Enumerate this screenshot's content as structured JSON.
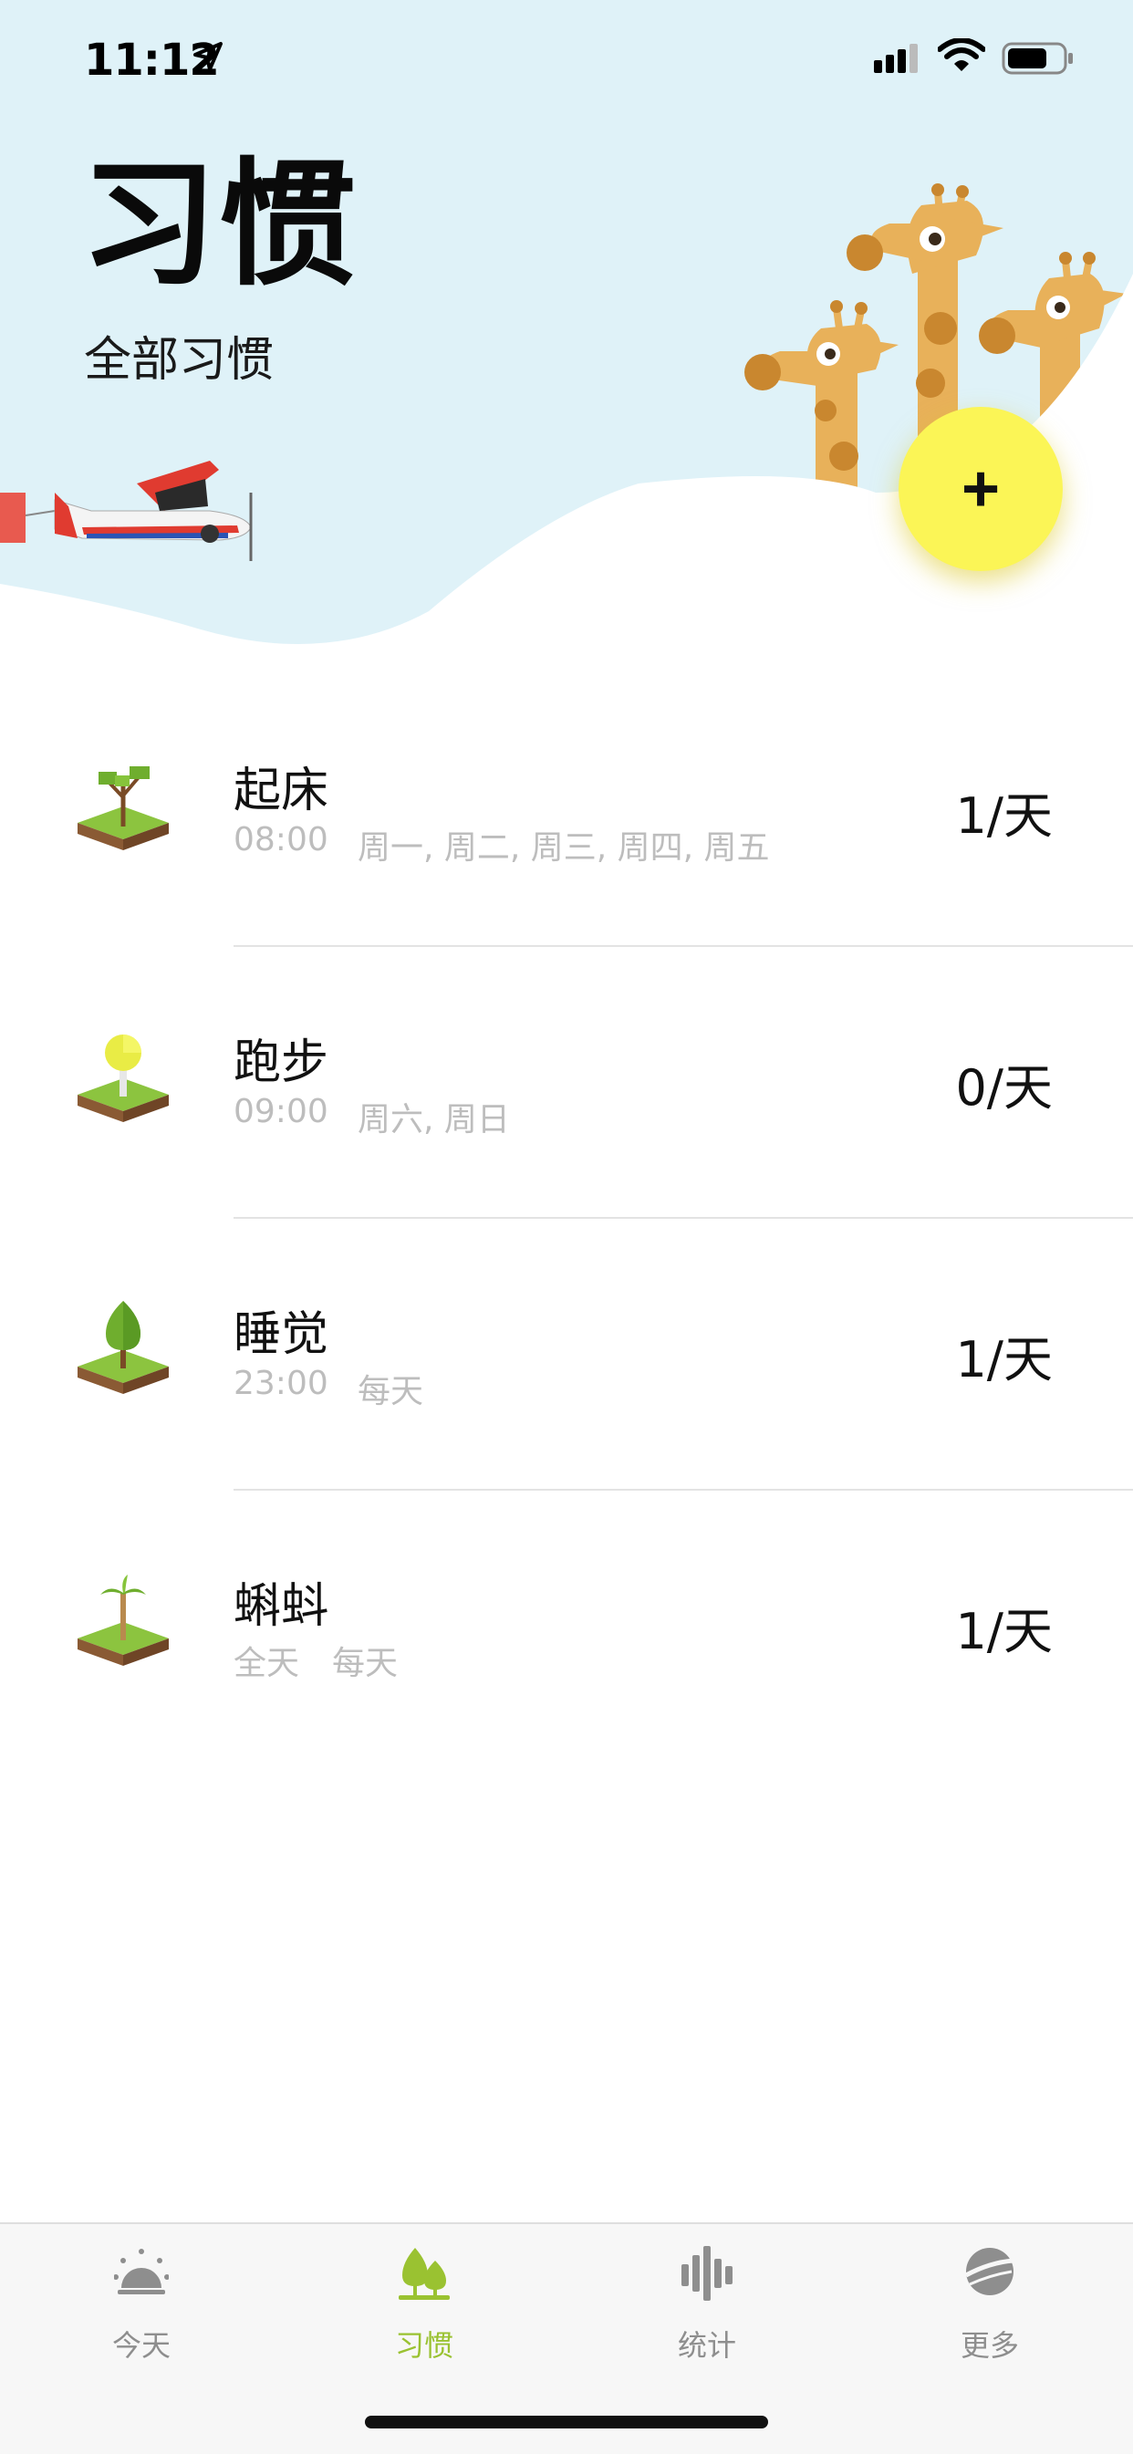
{
  "status_bar": {
    "time": "11:12"
  },
  "header": {
    "title": "习惯",
    "subtitle": "全部习惯"
  },
  "add_button": {
    "label": "+"
  },
  "habits": [
    {
      "name": "起床",
      "time": "08:00",
      "days": "周一, 周二, 周三, 周四, 周五",
      "count": "1/天",
      "icon": "bare-tree-icon"
    },
    {
      "name": "跑步",
      "time": "09:00",
      "days": "周六, 周日",
      "count": "0/天",
      "icon": "yellow-tree-icon"
    },
    {
      "name": "睡觉",
      "time": "23:00",
      "days": "每天",
      "count": "1/天",
      "icon": "green-tree-icon"
    },
    {
      "name": "蝌蚪",
      "time": "全天",
      "days": "每天",
      "count": "1/天",
      "icon": "palm-tree-icon"
    }
  ],
  "tab_bar": {
    "tabs": [
      {
        "label": "今天",
        "icon": "sunrise-icon",
        "active": false
      },
      {
        "label": "习惯",
        "icon": "trees-icon",
        "active": true
      },
      {
        "label": "统计",
        "icon": "bars-icon",
        "active": false
      },
      {
        "label": "更多",
        "icon": "planet-icon",
        "active": false
      }
    ]
  },
  "colors": {
    "header_bg": "#dff2f8",
    "accent_green": "#9ac231",
    "add_button": "#fbf556",
    "giraffe": "#e8b15a"
  }
}
